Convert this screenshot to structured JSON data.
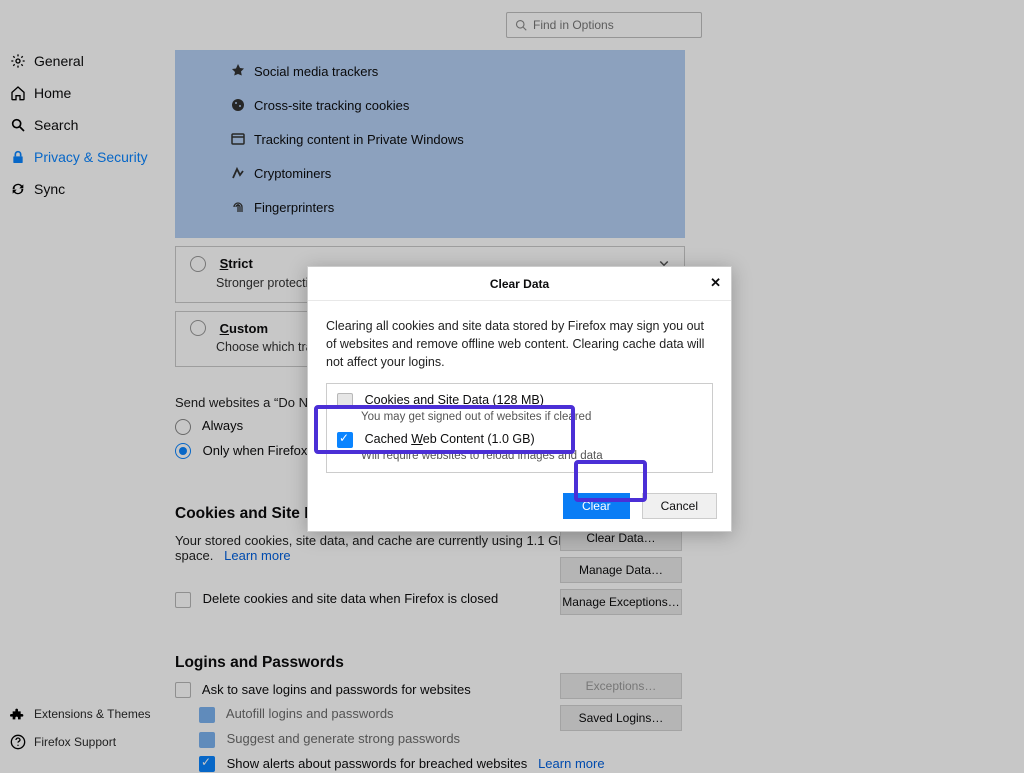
{
  "search": {
    "placeholder": "Find in Options"
  },
  "sidebar": {
    "items": [
      {
        "label": "General"
      },
      {
        "label": "Home"
      },
      {
        "label": "Search"
      },
      {
        "label": "Privacy & Security"
      },
      {
        "label": "Sync"
      }
    ],
    "bottom": [
      {
        "label": "Extensions & Themes"
      },
      {
        "label": "Firefox Support"
      }
    ]
  },
  "tracking": {
    "standard_items": [
      "Social media trackers",
      "Cross-site tracking cookies",
      "Tracking content in Private Windows",
      "Cryptominers",
      "Fingerprinters"
    ],
    "strict": {
      "title": "Strict",
      "desc": "Stronger protection"
    },
    "custom": {
      "title": "Custom",
      "desc": "Choose which tracke"
    }
  },
  "dnt": {
    "intro": "Send websites a “Do Not",
    "always": "Always",
    "only_when_a": "Only when Firefox is ",
    "only_when_b": ""
  },
  "cookies": {
    "heading": "Cookies and Site Data",
    "desc_a": "Your stored cookies, site data, and cache are currently using 1.1 GB of disk",
    "desc_b": "space.",
    "learn": "Learn more",
    "delete_label": "Delete cookies and site data when Firefox is closed"
  },
  "logins": {
    "heading": "Logins and Passwords",
    "ask": "Ask to save logins and passwords for websites",
    "autofill": "Autofill logins and passwords",
    "suggest": "Suggest and generate strong passwords",
    "alerts": "Show alerts about passwords for breached websites",
    "learn": "Learn more"
  },
  "buttons": {
    "clear_data": "Clear Data…",
    "manage_data": "Manage Data…",
    "manage_exceptions": "Manage Exceptions…",
    "exceptions": "Exceptions…",
    "saved_logins": "Saved Logins…"
  },
  "dialog": {
    "title": "Clear Data",
    "text": "Clearing all cookies and site data stored by Firefox may sign you out of websites and remove offline web content. Clearing cache data will not affect your logins.",
    "opt1": {
      "title_a": "Cookies and ",
      "title_b": "S",
      "title_c": "ite Data (128 MB)",
      "sub": "You may get signed out of websites if cleared"
    },
    "opt2": {
      "title_a": "Cached ",
      "title_b": "W",
      "title_c": "eb Content (1.0 GB)",
      "sub": "Will require websites to reload images and data"
    },
    "clear": "Clear",
    "cancel": "Cancel"
  }
}
